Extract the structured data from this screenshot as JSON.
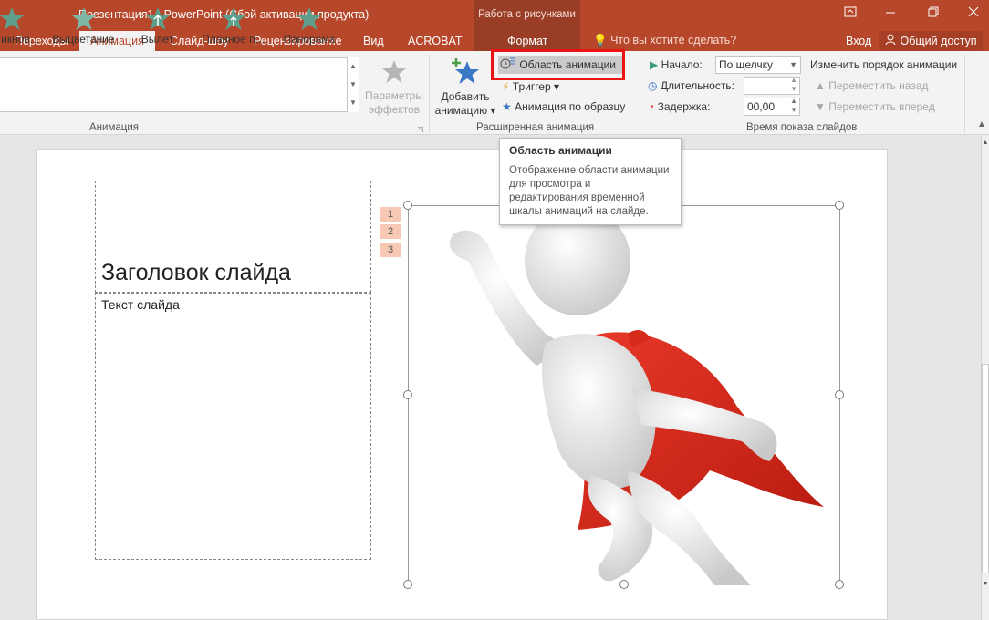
{
  "window": {
    "title": "Презентация1 - PowerPoint (Сбой активации продукта)",
    "context_group": "Работа с рисунками",
    "controls": [
      "ribbon-options-icon",
      "minimize-icon",
      "restore-icon",
      "close-icon"
    ]
  },
  "tabs": {
    "transitions": "Переходы",
    "animation": "Анимация",
    "slideshow": "Слайд-шоу",
    "review": "Рецензирование",
    "view": "Вид",
    "acrobat": "ACROBAT",
    "format": "Формат",
    "tell_me": "Что вы хотите сделать?",
    "signin": "Вход",
    "share": "Общий доступ"
  },
  "gallery": {
    "items": [
      "икнов...",
      "Выцветание",
      "Вылет",
      "Плавное п...",
      "Панорама"
    ],
    "star_color": "#5e9e8c"
  },
  "effects_btn": {
    "line1": "Параметры",
    "line2": "эффектов"
  },
  "add_anim": {
    "line1": "Добавить",
    "line2": "анимацию"
  },
  "advanced": {
    "pane": "Область анимации",
    "trigger": "Триггер",
    "painter": "Анимация по образцу"
  },
  "timing": {
    "start_label": "Начало:",
    "start_value": "По щелчку",
    "duration_label": "Длительность:",
    "duration_value": "",
    "delay_label": "Задержка:",
    "delay_value": "00,00",
    "reorder": "Изменить порядок анимации",
    "move_back": "Переместить назад",
    "move_fwd": "Переместить вперед"
  },
  "groups": {
    "animation": "Анимация",
    "advanced": "Расширенная анимация",
    "timing": "Время показа слайдов"
  },
  "tooltip": {
    "title": "Область анимации",
    "body": "Отображение области анимации для просмотра и редактирования временной шкалы анимаций на слайде."
  },
  "slide": {
    "title": "Заголовок слайда",
    "text": "Текст слайда",
    "tags": [
      "1",
      "2",
      "3"
    ]
  },
  "colors": {
    "accent": "#b7472a",
    "highlight": "#e81416",
    "cape": "#d62a1a"
  }
}
